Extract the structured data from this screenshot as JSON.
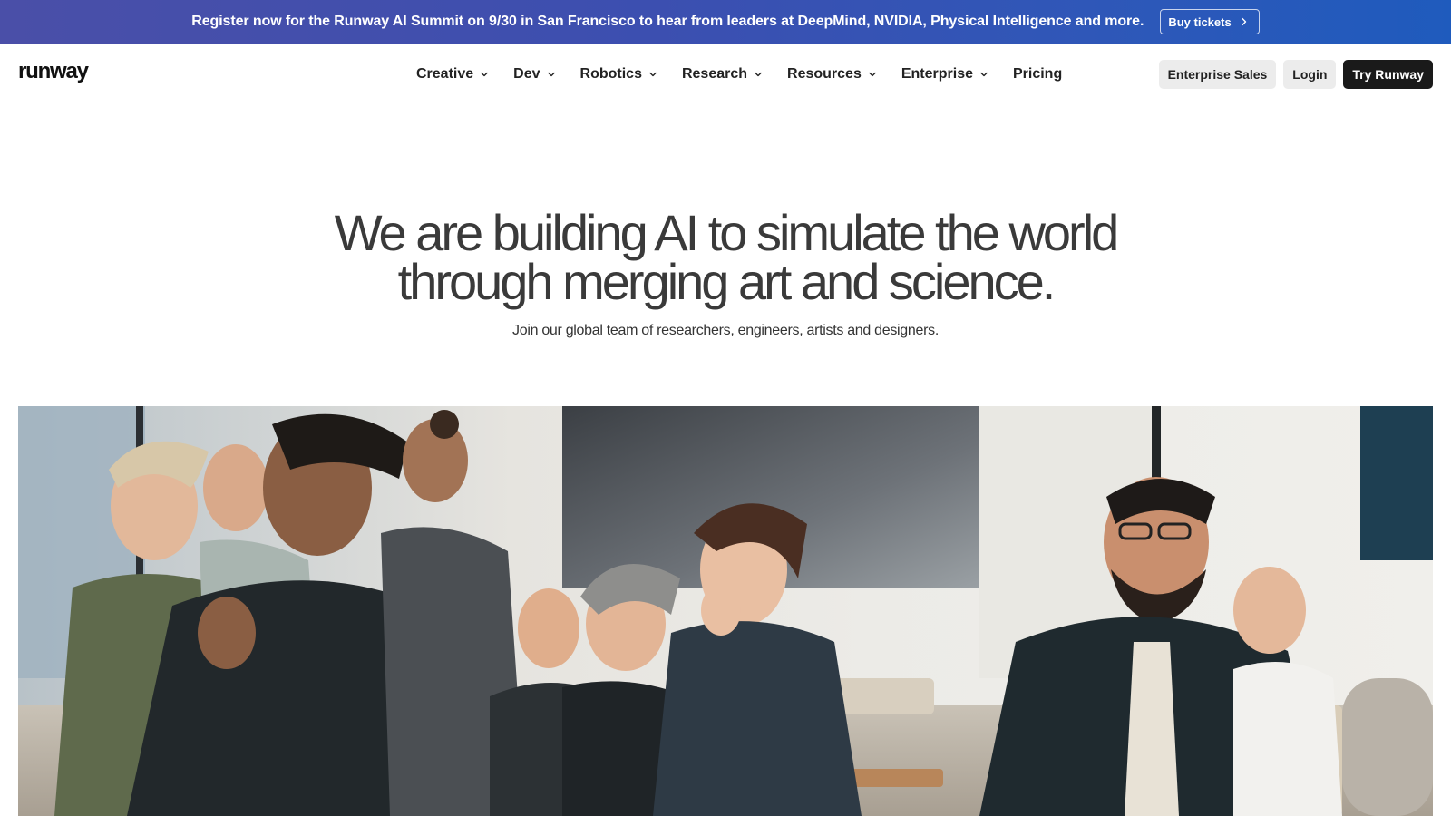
{
  "banner": {
    "text": "Register now for the Runway AI Summit on 9/30 in San Francisco to hear from leaders at DeepMind, NVIDIA, Physical Intelligence and more.",
    "button_label": "Buy tickets",
    "button_icon": "chevron-right-icon",
    "colors": {
      "gradient_start": "#4a4fa8",
      "gradient_end": "#1f5bbd"
    }
  },
  "nav": {
    "logo": "runway",
    "items": [
      {
        "label": "Creative",
        "has_dropdown": true
      },
      {
        "label": "Dev",
        "has_dropdown": true
      },
      {
        "label": "Robotics",
        "has_dropdown": true
      },
      {
        "label": "Research",
        "has_dropdown": true
      },
      {
        "label": "Resources",
        "has_dropdown": true
      },
      {
        "label": "Enterprise",
        "has_dropdown": true
      },
      {
        "label": "Pricing",
        "has_dropdown": false
      }
    ],
    "actions": {
      "enterprise_sales": "Enterprise Sales",
      "login": "Login",
      "try_runway": "Try Runway"
    }
  },
  "hero": {
    "title_line1": "We are building AI to simulate the world",
    "title_line2": "through merging art and science.",
    "subtitle": "Join our global team of researchers, engineers, artists and designers."
  },
  "photo": {
    "icon": "team-photo"
  }
}
